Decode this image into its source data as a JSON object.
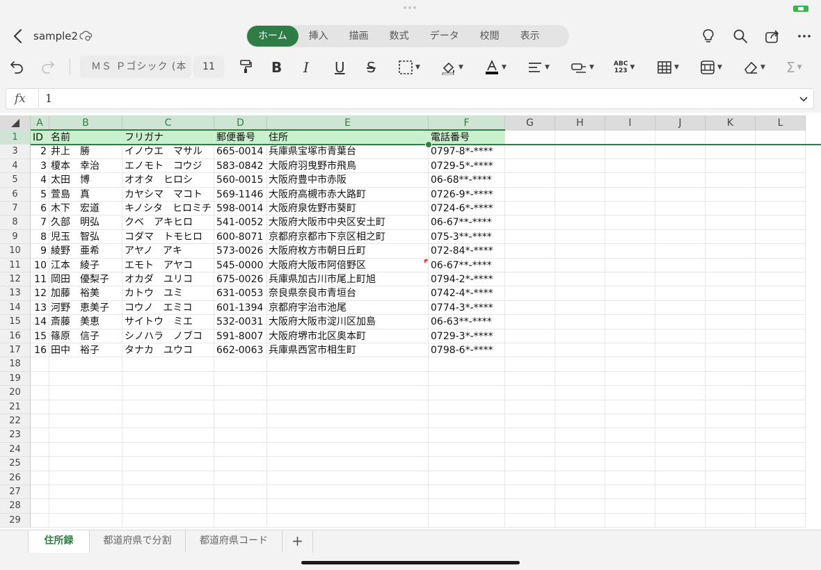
{
  "app": {
    "document_title": "sample2",
    "tabs": [
      {
        "label": "ホーム",
        "active": true
      },
      {
        "label": "挿入",
        "active": false
      },
      {
        "label": "描画",
        "active": false
      },
      {
        "label": "数式",
        "active": false
      },
      {
        "label": "データ",
        "active": false
      },
      {
        "label": "校閲",
        "active": false
      },
      {
        "label": "表示",
        "active": false
      }
    ],
    "accent_color": "#2f7d46"
  },
  "ribbon": {
    "font_name": "ＭＳ Ｐゴシック (本",
    "font_size": "11",
    "icons": [
      "undo-icon",
      "redo-icon",
      "format-painter-icon",
      "bold-icon",
      "italic-icon",
      "underline-icon",
      "strikethrough-icon",
      "borders-icon",
      "fill-color-icon",
      "font-color-icon",
      "align-icon",
      "wrap-icon",
      "number-format-icon",
      "table-icon",
      "cell-styles-icon",
      "clear-icon",
      "autosum-icon"
    ],
    "number_format_label_top": "ABC",
    "number_format_label_bottom": "123"
  },
  "formula_bar": {
    "fx_label": "fx",
    "value": "1"
  },
  "sheet": {
    "columns": [
      "A",
      "B",
      "C",
      "D",
      "E",
      "F",
      "G",
      "H",
      "I",
      "J",
      "K",
      "L"
    ],
    "header_row": [
      "ID",
      "名前",
      "フリガナ",
      "郵便番号",
      "住所",
      "電話番号"
    ],
    "rows": [
      {
        "row": "1",
        "cells": [
          "ID",
          "名前",
          "フリガナ",
          "郵便番号",
          "住所",
          "電話番号"
        ]
      },
      {
        "row": "3",
        "cells": [
          "2",
          "井上　勝",
          "イノウエ　マサル",
          "665-0014",
          "兵庫県宝塚市青葉台",
          "0797-8*-****"
        ]
      },
      {
        "row": "4",
        "cells": [
          "3",
          "榎本　幸治",
          "エノモト　コウジ",
          "583-0842",
          "大阪府羽曳野市飛鳥",
          "0729-5*-****"
        ]
      },
      {
        "row": "5",
        "cells": [
          "4",
          "太田　博",
          "オオタ　ヒロシ",
          "560-0015",
          "大阪府豊中市赤阪",
          "06-68**-****"
        ]
      },
      {
        "row": "6",
        "cells": [
          "5",
          "萱島　真",
          "カヤシマ　マコト",
          "569-1146",
          "大阪府高槻市赤大路町",
          "0726-9*-****"
        ]
      },
      {
        "row": "7",
        "cells": [
          "6",
          "木下　宏道",
          "キノシタ　ヒロミチ",
          "598-0014",
          "大阪府泉佐野市葵町",
          "0724-6*-****"
        ]
      },
      {
        "row": "8",
        "cells": [
          "7",
          "久部　明弘",
          "クベ　アキヒロ",
          "541-0052",
          "大阪府大阪市中央区安土町",
          "06-67**-****"
        ]
      },
      {
        "row": "9",
        "cells": [
          "8",
          "児玉　智弘",
          "コダマ　トモヒロ",
          "600-8071",
          "京都府京都市下京区相之町",
          "075-3**-****"
        ]
      },
      {
        "row": "10",
        "cells": [
          "9",
          "綾野　亜希",
          "アヤノ　アキ",
          "573-0026",
          "大阪府枚方市朝日丘町",
          "072-84*-****"
        ]
      },
      {
        "row": "11",
        "cells": [
          "10",
          "江本　綾子",
          "エモト　アヤコ",
          "545-0000",
          "大阪府大阪市阿倍野区",
          "06-67**-****"
        ]
      },
      {
        "row": "12",
        "cells": [
          "11",
          "岡田　優梨子",
          "オカダ　ユリコ",
          "675-0026",
          "兵庫県加古川市尾上町旭",
          "0794-2*-****"
        ]
      },
      {
        "row": "13",
        "cells": [
          "12",
          "加藤　裕美",
          "カトウ　ユミ",
          "631-0053",
          "奈良県奈良市青垣台",
          "0742-4*-****"
        ]
      },
      {
        "row": "14",
        "cells": [
          "13",
          "河野　恵美子",
          "コウノ　エミコ",
          "601-1394",
          "京都府宇治市池尾",
          "0774-3*-****"
        ]
      },
      {
        "row": "15",
        "cells": [
          "14",
          "斎藤　美恵",
          "サイトウ　ミエ",
          "532-0031",
          "大阪府大阪市淀川区加島",
          "06-63**-****"
        ]
      },
      {
        "row": "16",
        "cells": [
          "15",
          "篠原　信子",
          "シノハラ　ノブコ",
          "591-8007",
          "大阪府堺市北区奥本町",
          "0729-3*-****"
        ]
      },
      {
        "row": "17",
        "cells": [
          "16",
          "田中　裕子",
          "タナカ　ユウコ",
          "662-0063",
          "兵庫県西宮市相生町",
          "0798-6*-****"
        ]
      },
      {
        "row": "18",
        "cells": []
      },
      {
        "row": "19",
        "cells": []
      },
      {
        "row": "20",
        "cells": []
      },
      {
        "row": "21",
        "cells": []
      },
      {
        "row": "22",
        "cells": []
      },
      {
        "row": "23",
        "cells": []
      },
      {
        "row": "24",
        "cells": []
      },
      {
        "row": "25",
        "cells": []
      },
      {
        "row": "26",
        "cells": []
      },
      {
        "row": "27",
        "cells": []
      },
      {
        "row": "28",
        "cells": []
      },
      {
        "row": "29",
        "cells": []
      }
    ]
  },
  "sheet_tabs": [
    {
      "label": "住所録",
      "active": true
    },
    {
      "label": "都道府県で分割",
      "active": false
    },
    {
      "label": "都道府県コード",
      "active": false
    }
  ],
  "add_sheet_label": "+"
}
